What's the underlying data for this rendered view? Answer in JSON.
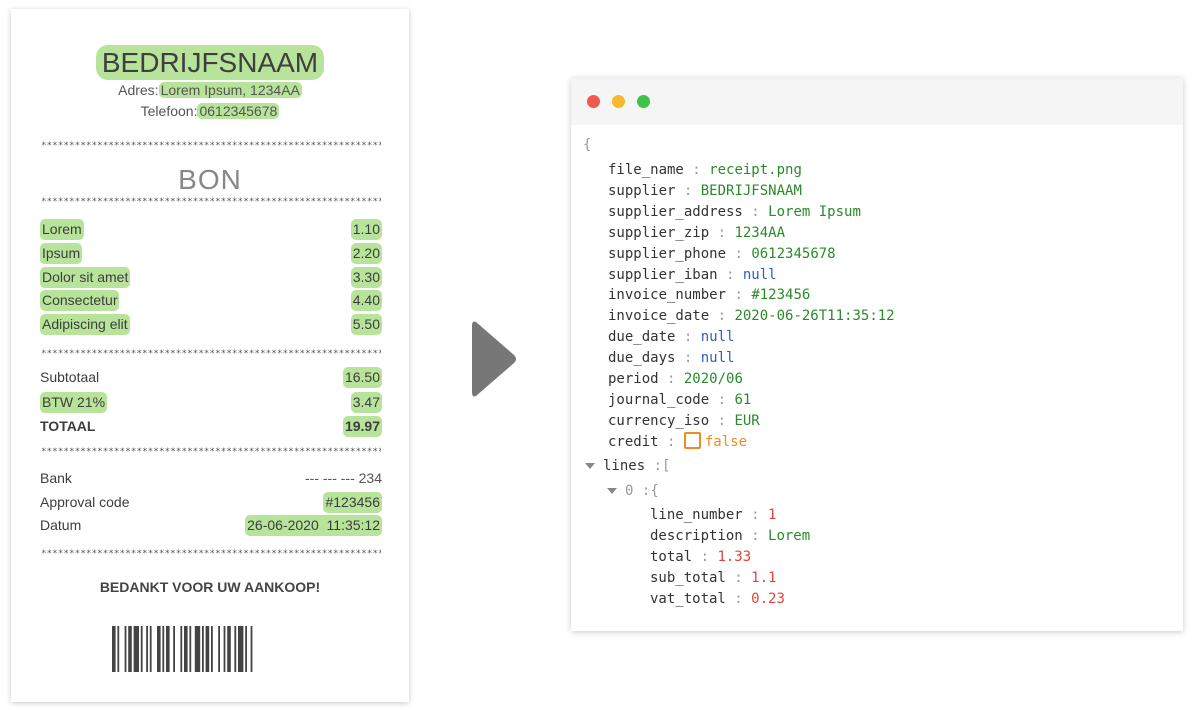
{
  "receipt": {
    "company": "BEDRIJFSNAAM",
    "address_label": "Adres:",
    "address_value": "Lorem Ipsum, 1234AA",
    "phone_label": "Telefoon:",
    "phone_value": "0612345678",
    "stars": "****************************************************************************",
    "title": "BON",
    "items": [
      {
        "name": "Lorem",
        "price": "1.10"
      },
      {
        "name": "Ipsum",
        "price": "2.20"
      },
      {
        "name": "Dolor sit amet",
        "price": "3.30"
      },
      {
        "name": "Consectetur",
        "price": "4.40"
      },
      {
        "name": "Adipiscing elit",
        "price": "5.50"
      }
    ],
    "subtotal_label": "Subtotaal",
    "subtotal_value": "16.50",
    "vat_label": "BTW 21%",
    "vat_value": "3.47",
    "total_label": "TOTAAL",
    "total_value": "19.97",
    "bank_label": "Bank",
    "bank_value": "--- --- --- 234",
    "approval_label": "Approval code",
    "approval_value": "#123456",
    "date_label": "Datum",
    "date_value": "26-06-2020  11:35:12",
    "thanks": "BEDANKT VOOR UW AANKOOP!"
  },
  "window": {
    "dot_colors": [
      "#ee5a52",
      "#f5b82e",
      "#3fc24a"
    ]
  },
  "json": {
    "open_brace": "{",
    "sep": ":",
    "fields": [
      {
        "key": "file_name",
        "value": "receipt.png",
        "type": "string"
      },
      {
        "key": "supplier",
        "value": "BEDRIJFSNAAM",
        "type": "string"
      },
      {
        "key": "supplier_address",
        "value": "Lorem Ipsum",
        "type": "string"
      },
      {
        "key": "supplier_zip",
        "value": "1234AA",
        "type": "string"
      },
      {
        "key": "supplier_phone",
        "value": "0612345678",
        "type": "string"
      },
      {
        "key": "supplier_iban",
        "value": "null",
        "type": "null"
      },
      {
        "key": "invoice_number",
        "value": "#123456",
        "type": "string"
      },
      {
        "key": "invoice_date",
        "value": "2020-06-26T11:35:12",
        "type": "string"
      },
      {
        "key": "due_date",
        "value": "null",
        "type": "null"
      },
      {
        "key": "due_days",
        "value": "null",
        "type": "null"
      },
      {
        "key": "period",
        "value": "2020/06",
        "type": "string"
      },
      {
        "key": "journal_code",
        "value": "61",
        "type": "string"
      },
      {
        "key": "currency_iso",
        "value": "EUR",
        "type": "string"
      },
      {
        "key": "credit",
        "value": "false",
        "type": "bool"
      }
    ],
    "lines_key": "lines",
    "lines_open": "[",
    "item_index": "0",
    "item_open": "{",
    "line_fields": [
      {
        "key": "line_number",
        "value": "1",
        "type": "number"
      },
      {
        "key": "description",
        "value": "Lorem",
        "type": "string"
      },
      {
        "key": "total",
        "value": "1.33",
        "type": "number"
      },
      {
        "key": "sub_total",
        "value": "1.1",
        "type": "number"
      },
      {
        "key": "vat_total",
        "value": "0.23",
        "type": "number"
      }
    ]
  }
}
